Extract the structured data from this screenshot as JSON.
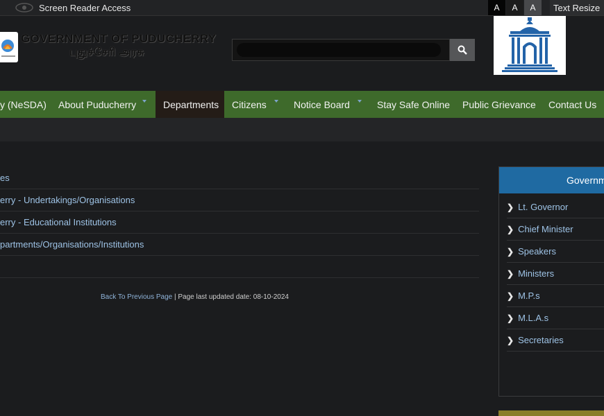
{
  "topbar": {
    "screen_reader": "Screen Reader Access",
    "text_sizes": [
      "A",
      "A",
      "A"
    ],
    "text_resize": "Text Resize"
  },
  "header": {
    "title": "GOVERNMENT OF PUDUCHERRY",
    "tamil_title": "புதுச்சேரி அரசு",
    "search_placeholder": ""
  },
  "nav": {
    "items": [
      {
        "label": "y (NeSDA)"
      },
      {
        "label": "About Puducherry"
      },
      {
        "label": "Departments"
      },
      {
        "label": "Citizens"
      },
      {
        "label": "Notice Board"
      },
      {
        "label": "Stay Safe Online"
      },
      {
        "label": "Public Grievance"
      },
      {
        "label": "Contact Us"
      }
    ]
  },
  "main": {
    "list": [
      "es",
      "erry - Undertakings/Organisations",
      "erry - Educational Institutions",
      "partments/Organisations/Institutions",
      ""
    ],
    "back_link": "Back To Previous Page",
    "updated": " | Page last updated date: 08-10-2024"
  },
  "sidebar": {
    "heading": "Governm",
    "items": [
      "Lt. Governor",
      "Chief Minister",
      "Speakers",
      "Ministers",
      "M.P.s",
      "M.L.A.s",
      "Secretaries"
    ]
  },
  "colors": {
    "nav_bg": "#3e6a2b",
    "nav_active": "#241c17",
    "panel_head": "#1f6aa2",
    "link": "#9ec3e6"
  }
}
